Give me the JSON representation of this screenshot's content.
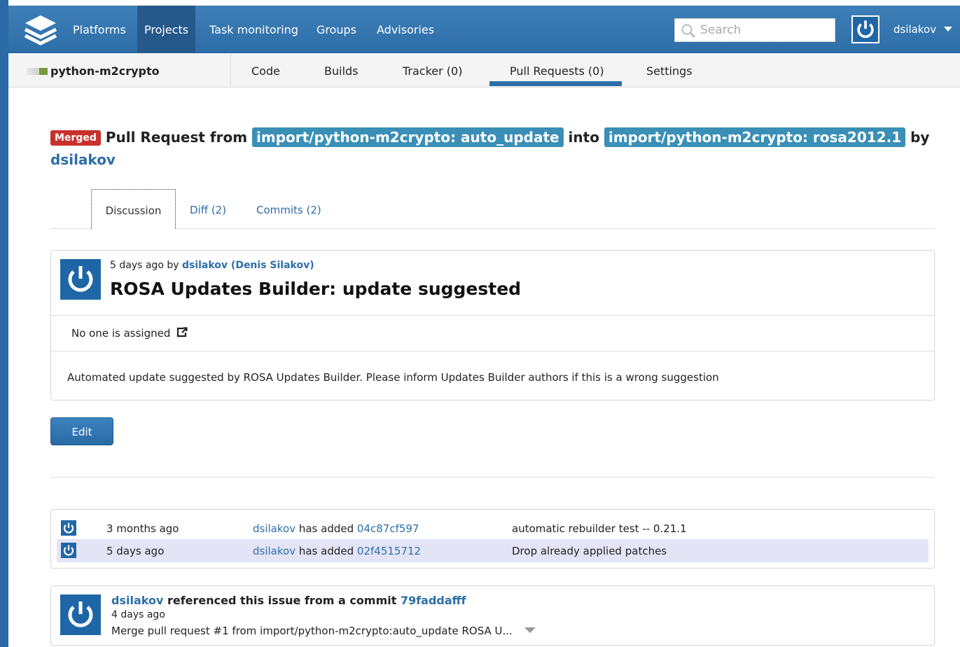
{
  "topnav": {
    "items": [
      "Platforms",
      "Projects",
      "Task monitoring",
      "Groups",
      "Advisories"
    ],
    "search_placeholder": "Search",
    "user": "dsilakov"
  },
  "subnav": {
    "project_name": "python-m2crypto",
    "tabs": [
      "Code",
      "Builds",
      "Tracker (0)",
      "Pull Requests (0)",
      "Settings"
    ]
  },
  "pull_request": {
    "status": "Merged",
    "text_from": "Pull Request from",
    "from_branch": "import/python-m2crypto: auto_update",
    "text_into": "into",
    "into_branch": "import/python-m2crypto: rosa2012.1",
    "text_by": "by",
    "author": "dsilakov"
  },
  "tabs": [
    "Discussion",
    "Diff (2)",
    "Commits (2)"
  ],
  "discussion": {
    "meta_prefix": "5 days ago by",
    "meta_author": "dsilakov (Denis Silakov)",
    "title": "ROSA Updates Builder: update suggested",
    "assigned": "No one is assigned",
    "description": "Automated update suggested by ROSA Updates Builder. Please inform Updates Builder authors if this is a wrong suggestion"
  },
  "edit_label": "Edit",
  "commits": [
    {
      "ago": "3 months ago",
      "user": "dsilakov",
      "action": "has added",
      "sha": "04c87cf597",
      "message": "automatic rebuilder test -- 0.21.1"
    },
    {
      "ago": "5 days ago",
      "user": "dsilakov",
      "action": "has added",
      "sha": "02f4515712",
      "message": "Drop already applied patches"
    }
  ],
  "reference": {
    "user": "dsilakov",
    "text": "referenced this issue from a commit",
    "sha": "79faddafff",
    "ago": "4 days ago",
    "message": "Merge pull request #1 from import/python-m2crypto:auto_update ROSA U..."
  },
  "colors": {
    "brand": "#2d6ea8",
    "merged": "#c9302c",
    "branch": "#3a8fb7",
    "highlight_row": "#e4e4f7"
  }
}
